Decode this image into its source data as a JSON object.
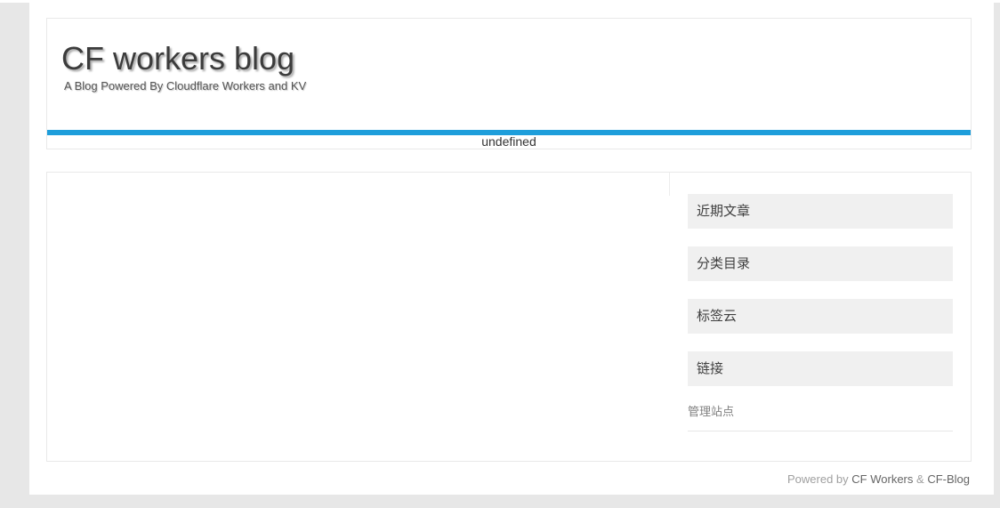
{
  "colors": {
    "accent_blue": "#1e9edb",
    "page_background": "#e7e7e7",
    "widget_background": "#f0f0f0"
  },
  "header": {
    "title": "CF workers blog",
    "subtitle": "A Blog Powered By Cloudflare Workers and KV",
    "nav_text": "undefined"
  },
  "sidebar": {
    "widgets": [
      {
        "label": "近期文章"
      },
      {
        "label": "分类目录"
      },
      {
        "label": "标签云"
      },
      {
        "label": "链接"
      }
    ],
    "admin_link_label": "管理站点"
  },
  "footer": {
    "prefix": "Powered by",
    "workers_link": "CF Workers",
    "separator": "&",
    "blog_link": "CF-Blog"
  }
}
